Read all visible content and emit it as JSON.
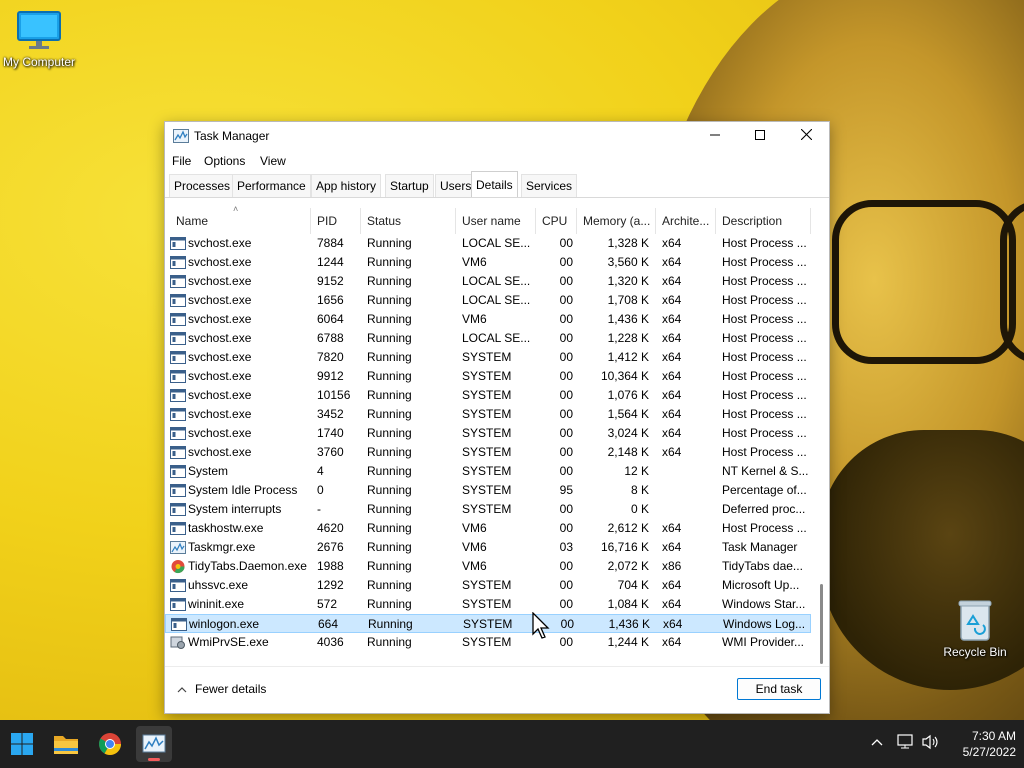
{
  "desktop": {
    "icons": [
      {
        "label": "My Computer"
      },
      {
        "label": "Recycle Bin"
      }
    ]
  },
  "window": {
    "title": "Task Manager",
    "menu": [
      "File",
      "Options",
      "View"
    ],
    "tabs": [
      "Processes",
      "Performance",
      "App history",
      "Startup",
      "Users",
      "Details",
      "Services"
    ],
    "active_tab": "Details",
    "columns": [
      "Name",
      "PID",
      "Status",
      "User name",
      "CPU",
      "Memory (a...",
      "Archite...",
      "Description"
    ],
    "sorted_column": "Name",
    "rows": [
      {
        "icon": "service-icon",
        "name": "svchost.exe",
        "pid": "7884",
        "status": "Running",
        "user": "LOCAL SE...",
        "cpu": "00",
        "mem": "1,328 K",
        "arch": "x64",
        "desc": "Host Process ..."
      },
      {
        "icon": "service-icon",
        "name": "svchost.exe",
        "pid": "1244",
        "status": "Running",
        "user": "VM6",
        "cpu": "00",
        "mem": "3,560 K",
        "arch": "x64",
        "desc": "Host Process ..."
      },
      {
        "icon": "service-icon",
        "name": "svchost.exe",
        "pid": "9152",
        "status": "Running",
        "user": "LOCAL SE...",
        "cpu": "00",
        "mem": "1,320 K",
        "arch": "x64",
        "desc": "Host Process ..."
      },
      {
        "icon": "service-icon",
        "name": "svchost.exe",
        "pid": "1656",
        "status": "Running",
        "user": "LOCAL SE...",
        "cpu": "00",
        "mem": "1,708 K",
        "arch": "x64",
        "desc": "Host Process ..."
      },
      {
        "icon": "service-icon",
        "name": "svchost.exe",
        "pid": "6064",
        "status": "Running",
        "user": "VM6",
        "cpu": "00",
        "mem": "1,436 K",
        "arch": "x64",
        "desc": "Host Process ..."
      },
      {
        "icon": "service-icon",
        "name": "svchost.exe",
        "pid": "6788",
        "status": "Running",
        "user": "LOCAL SE...",
        "cpu": "00",
        "mem": "1,228 K",
        "arch": "x64",
        "desc": "Host Process ..."
      },
      {
        "icon": "service-icon",
        "name": "svchost.exe",
        "pid": "7820",
        "status": "Running",
        "user": "SYSTEM",
        "cpu": "00",
        "mem": "1,412 K",
        "arch": "x64",
        "desc": "Host Process ..."
      },
      {
        "icon": "service-icon",
        "name": "svchost.exe",
        "pid": "9912",
        "status": "Running",
        "user": "SYSTEM",
        "cpu": "00",
        "mem": "10,364 K",
        "arch": "x64",
        "desc": "Host Process ..."
      },
      {
        "icon": "service-icon",
        "name": "svchost.exe",
        "pid": "10156",
        "status": "Running",
        "user": "SYSTEM",
        "cpu": "00",
        "mem": "1,076 K",
        "arch": "x64",
        "desc": "Host Process ..."
      },
      {
        "icon": "service-icon",
        "name": "svchost.exe",
        "pid": "3452",
        "status": "Running",
        "user": "SYSTEM",
        "cpu": "00",
        "mem": "1,564 K",
        "arch": "x64",
        "desc": "Host Process ..."
      },
      {
        "icon": "service-icon",
        "name": "svchost.exe",
        "pid": "1740",
        "status": "Running",
        "user": "SYSTEM",
        "cpu": "00",
        "mem": "3,024 K",
        "arch": "x64",
        "desc": "Host Process ..."
      },
      {
        "icon": "service-icon",
        "name": "svchost.exe",
        "pid": "3760",
        "status": "Running",
        "user": "SYSTEM",
        "cpu": "00",
        "mem": "2,148 K",
        "arch": "x64",
        "desc": "Host Process ..."
      },
      {
        "icon": "service-icon",
        "name": "System",
        "pid": "4",
        "status": "Running",
        "user": "SYSTEM",
        "cpu": "00",
        "mem": "12 K",
        "arch": "",
        "desc": "NT Kernel & S..."
      },
      {
        "icon": "service-icon",
        "name": "System Idle Process",
        "pid": "0",
        "status": "Running",
        "user": "SYSTEM",
        "cpu": "95",
        "mem": "8 K",
        "arch": "",
        "desc": "Percentage of..."
      },
      {
        "icon": "service-icon",
        "name": "System interrupts",
        "pid": "-",
        "status": "Running",
        "user": "SYSTEM",
        "cpu": "00",
        "mem": "0 K",
        "arch": "",
        "desc": "Deferred proc..."
      },
      {
        "icon": "service-icon",
        "name": "taskhostw.exe",
        "pid": "4620",
        "status": "Running",
        "user": "VM6",
        "cpu": "00",
        "mem": "2,612 K",
        "arch": "x64",
        "desc": "Host Process ..."
      },
      {
        "icon": "taskmgr-icon",
        "name": "Taskmgr.exe",
        "pid": "2676",
        "status": "Running",
        "user": "VM6",
        "cpu": "03",
        "mem": "16,716 K",
        "arch": "x64",
        "desc": "Task Manager"
      },
      {
        "icon": "tidytabs-icon",
        "name": "TidyTabs.Daemon.exe",
        "pid": "1988",
        "status": "Running",
        "user": "VM6",
        "cpu": "00",
        "mem": "2,072 K",
        "arch": "x86",
        "desc": "TidyTabs dae..."
      },
      {
        "icon": "service-icon",
        "name": "uhssvc.exe",
        "pid": "1292",
        "status": "Running",
        "user": "SYSTEM",
        "cpu": "00",
        "mem": "704 K",
        "arch": "x64",
        "desc": "Microsoft Up..."
      },
      {
        "icon": "service-icon",
        "name": "wininit.exe",
        "pid": "572",
        "status": "Running",
        "user": "SYSTEM",
        "cpu": "00",
        "mem": "1,084 K",
        "arch": "x64",
        "desc": "Windows Star..."
      },
      {
        "icon": "service-icon",
        "name": "winlogon.exe",
        "pid": "664",
        "status": "Running",
        "user": "SYSTEM",
        "cpu": "00",
        "mem": "1,436 K",
        "arch": "x64",
        "desc": "Windows Log...",
        "selected": true
      },
      {
        "icon": "wmi-icon",
        "name": "WmiPrvSE.exe",
        "pid": "4036",
        "status": "Running",
        "user": "SYSTEM",
        "cpu": "00",
        "mem": "1,244 K",
        "arch": "x64",
        "desc": "WMI Provider..."
      }
    ],
    "footer": {
      "fewer_details": "Fewer details",
      "end_task": "End task"
    }
  },
  "taskbar": {
    "pinned": [
      "start-icon",
      "file-explorer-icon",
      "chrome-icon",
      "task-manager-icon"
    ],
    "tray_icons": [
      "chevron-up-icon",
      "network-icon",
      "volume-icon"
    ],
    "clock": {
      "time": "7:30 AM",
      "date": "5/27/2022"
    }
  },
  "colors": {
    "selection": "#cce8ff",
    "accent": "#0078d4",
    "taskbar": "#202020"
  }
}
